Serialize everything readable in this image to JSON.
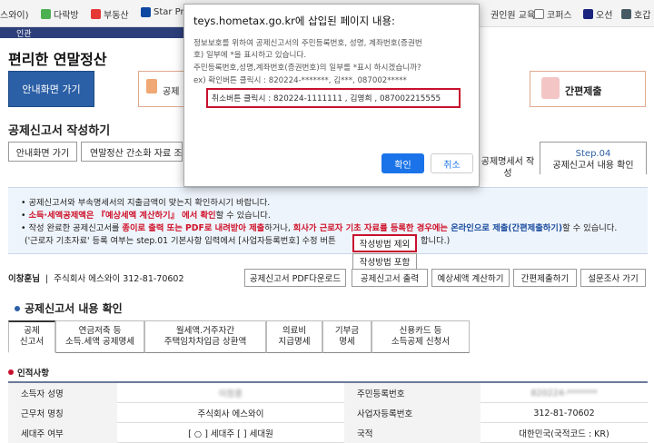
{
  "bookmarks": [
    {
      "label": "스와이)",
      "color": "#3a7bd5"
    },
    {
      "label": "다락방",
      "color": "#4caf50"
    },
    {
      "label": "부동산",
      "color": "#e53935"
    },
    {
      "label": "Star Pro",
      "color": "#0d47a1"
    },
    {
      "label": "권인원 교육",
      "color": "#1565c0"
    },
    {
      "label": "코퍼스",
      "color": "#555555"
    },
    {
      "label": "오선",
      "color": "#1a237e"
    },
    {
      "label": "호갑",
      "color": "#455a64"
    }
  ],
  "header": {
    "nav_label": "인관",
    "title": "편리한 연말정산",
    "guide_button": "안내화면 가기",
    "step_partial": "공제",
    "simple_submit": "간편제출"
  },
  "section_title": "공제신고서 작성하기",
  "tabs": {
    "guide": "안내화면 가기",
    "simplified": "연말정산 간소화 자료 조회",
    "detail": "공제명세서 작성",
    "step_no": "Step.04",
    "step_label": "공제신고서 내용 확인"
  },
  "info": {
    "line1": "공제신고서와 부속명세서의 지출금액이 맞는지 확인하시기 바랍니다.",
    "line2_red": "소득·세액공제액은 『예상세액 계산하기』 에서 확인",
    "line2_rest": "할 수 있습니다.",
    "line3_a": "작성 완료한 공제신고서를 ",
    "line3_red1": "종이로 출력 또는 PDF로 내려받아 제출",
    "line3_b": "하거나, ",
    "line3_red2": "회사가 근로자 기초 자료를 등록한 경우에는 ",
    "line3_blue": "온라인으로 제출(간편제출하기)",
    "line3_c": "할 수 있습니다.",
    "line4_a": "('근로자 기초자료' 등록 여부는 step.01 기본사항 입력에서 [사업자등록번호] 수정 버튼 ",
    "line4_b": "합니다.)"
  },
  "company": {
    "name": "이창훈님",
    "firm": "주식회사 에스와이 312-81-70602"
  },
  "actions": [
    "공제신고서 PDF다운로드",
    "공제신고서 출력",
    "예상세액 계산하기",
    "간편제출하기",
    "설문조사 가기"
  ],
  "dropdown": {
    "option1": "작성방법 제외",
    "option2": "작성방법 포함"
  },
  "content_title": "공제신고서 내용 확인",
  "content_tabs": [
    "공제\n신고서",
    "연금저축 등\n소득.세액 공제명세",
    "월세액.거주자간\n주택임차차입금 상환액",
    "의료비\n지급명세",
    "기부금\n명세",
    "신용카드 등\n소득공제 신청서"
  ],
  "personal": {
    "heading": "인적사항",
    "rows": [
      {
        "l1": "소득자 성명",
        "v1": "이창훈",
        "l2": "주민등록번호",
        "v2": "820224-*******"
      },
      {
        "l1": "근무처 명칭",
        "v1": "주식회사 에스와이",
        "l2": "사업자등록번호",
        "v2": "312-81-70602"
      },
      {
        "l1": "세대주 여부",
        "v1": "[ ○ ] 세대주  [   ] 세대원",
        "l2": "국적",
        "v2": "대한민국(국적코드 : KR)"
      }
    ]
  },
  "dialog": {
    "host": "teys.hometax.go.kr에 삽입된 페이지 내용:",
    "lines": [
      "정보보호를 위하여 공제신고서의 주민등록번호, 성명, 계좌번호(증권번",
      "호) 일부에 *을 표시하고 있습니다.",
      "주민등록번호,성명,계좌번호(증권번호)의 일부를 *표시 하시겠습니까?",
      "ex) 확인버튼 클릭시 : 820224-*******, 김***, 087002*****"
    ],
    "highlight": "취소버튼 클릭시 : 820224-1111111 , 김영희 , 087002215555",
    "ok": "확인",
    "cancel": "취소"
  }
}
